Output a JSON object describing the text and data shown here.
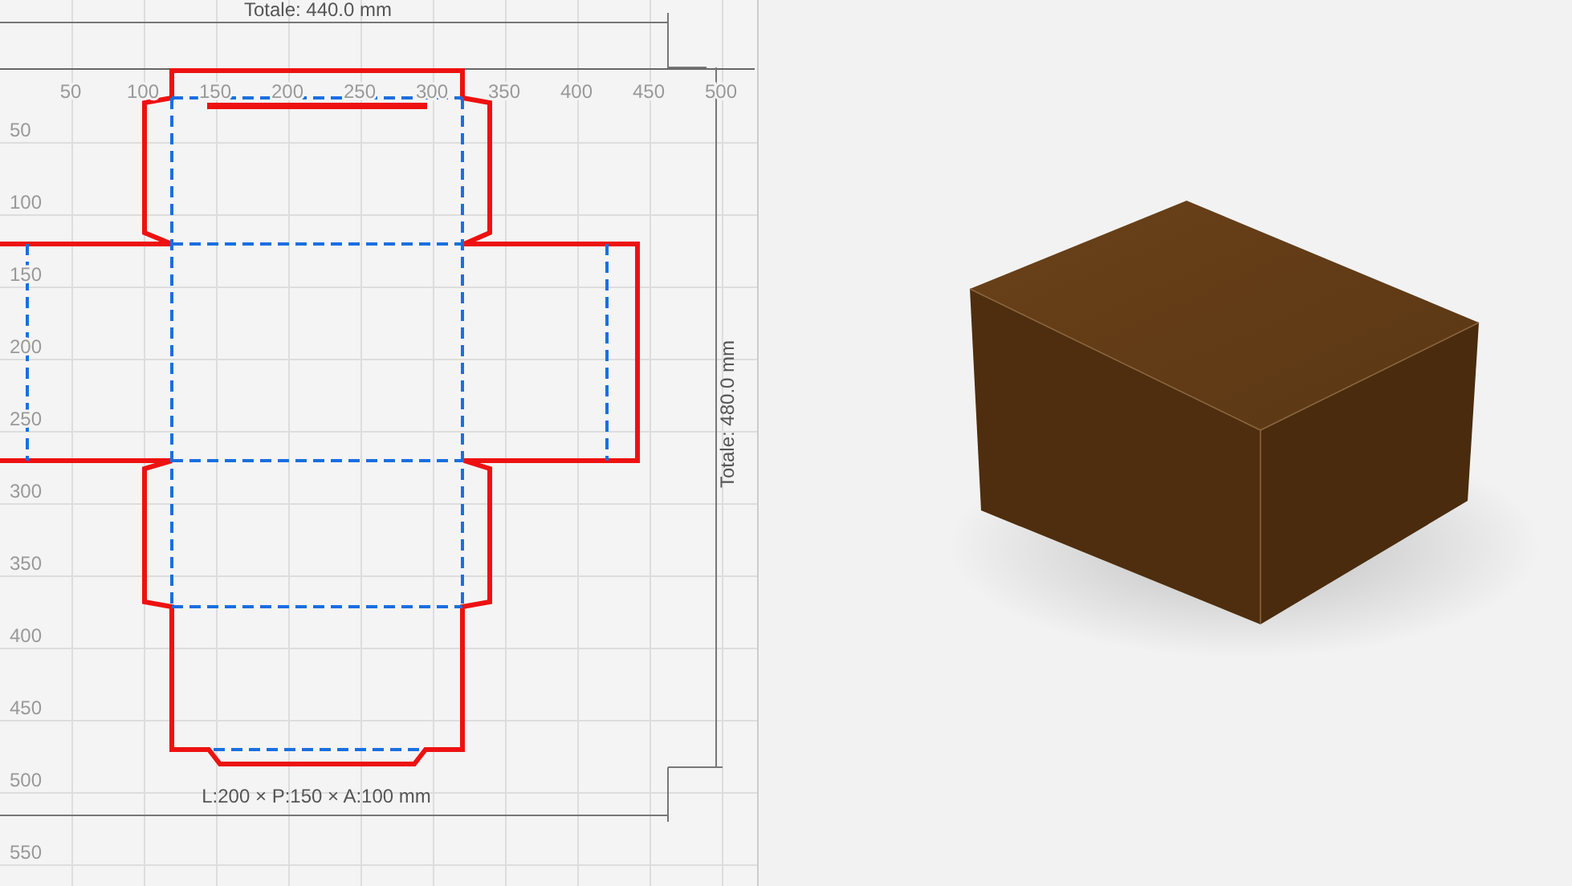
{
  "dieline_view": {
    "width_total": "Totale: 440.0 mm",
    "height_total": "Totale: 480.0 mm",
    "x_ticks": [
      "50",
      "100",
      "150",
      "200",
      "250",
      "300",
      "350",
      "400",
      "450",
      "500"
    ],
    "y_ticks": [
      "50",
      "100",
      "150",
      "200",
      "250",
      "300",
      "350",
      "400",
      "450",
      "500",
      "550"
    ],
    "size_label": "L:200 × P:150 × A:100 mm"
  }
}
